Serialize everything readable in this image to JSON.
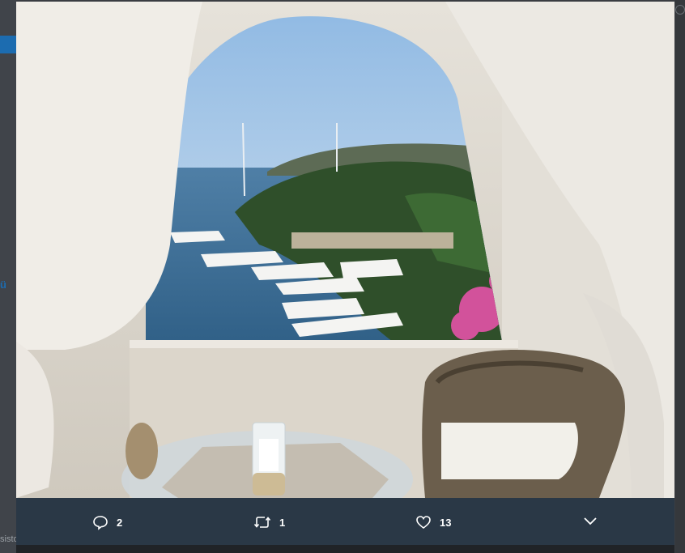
{
  "page": {
    "backdrop_fragment": "sisto"
  },
  "tweet_actions": {
    "reply": {
      "icon": "reply-icon",
      "count": "2"
    },
    "retweet": {
      "icon": "retweet-icon",
      "count": "1"
    },
    "like": {
      "icon": "heart-icon",
      "count": "13"
    },
    "more": {
      "icon": "chevron-down-icon"
    }
  },
  "colors": {
    "action_bar": "#2a3846",
    "text": "#ffffff"
  }
}
